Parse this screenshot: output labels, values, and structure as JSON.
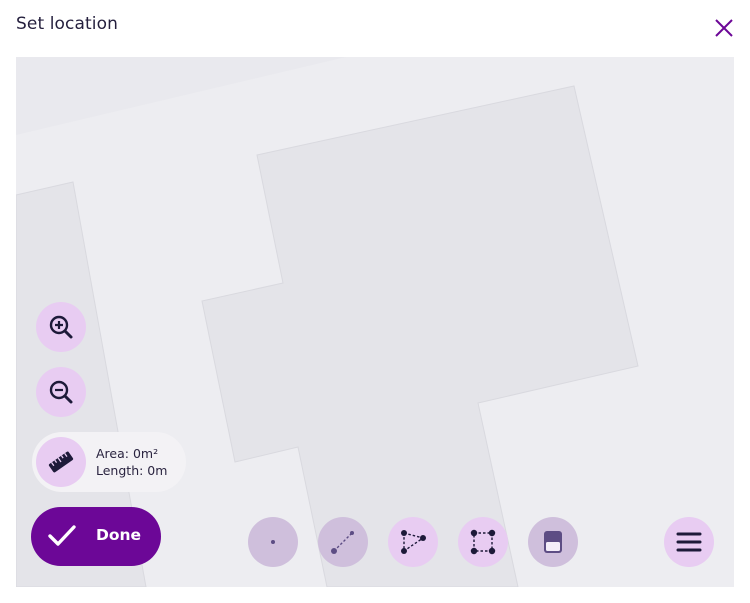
{
  "dialog": {
    "title": "Set location"
  },
  "measure": {
    "area": "Area: 0m²",
    "length": "Length: 0m"
  },
  "done_label": "Done",
  "colors": {
    "accent": "#6c0797",
    "button_bg": "#e8ccf2",
    "button_disabled_bg": "#cfbfdc",
    "map_bg": "#ededf1",
    "building": "#e4e4e9"
  },
  "toolbar": {
    "tools": [
      {
        "name": "point-tool",
        "state": "disabled"
      },
      {
        "name": "line-tool",
        "state": "disabled"
      },
      {
        "name": "polygon-tool",
        "state": "enabled"
      },
      {
        "name": "rectangle-tool",
        "state": "enabled"
      },
      {
        "name": "layer-tool",
        "state": "disabled"
      }
    ]
  }
}
